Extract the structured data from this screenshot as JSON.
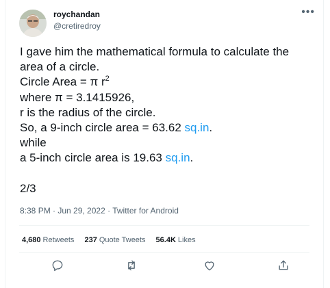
{
  "author": {
    "name": "roychandan",
    "handle": "@cretiredroy"
  },
  "tweet": {
    "line1": "I gave him the  mathematical formula to calculate the",
    "line2": "area of a circle.",
    "line3_text": "Circle Area = π r",
    "line3_sup": "2",
    "line4": "where π = 3.1415926,",
    "line5": "r is the radius of the circle.",
    "line6_text": "So, a 9-inch circle area = 63.62 ",
    "line6_link": "sq.in",
    "line6_end": ".",
    "line7": "while",
    "line8_text": "a 5-inch circle area is 19.63 ",
    "line8_link": "sq.in",
    "line8_end": ".",
    "thread_position": "2/3"
  },
  "meta": "8:38 PM · Jun 29, 2022 · Twitter for Android",
  "stats": {
    "retweets_count": "4,680",
    "retweets_label": "Retweets",
    "quotes_count": "237",
    "quotes_label": "Quote Tweets",
    "likes_count": "56.4K",
    "likes_label": "Likes"
  },
  "icons": {
    "more": "more-icon",
    "reply": "reply-icon",
    "retweet": "retweet-icon",
    "like": "heart-icon",
    "share": "share-icon"
  },
  "colors": {
    "link": "#1d9bf0",
    "secondary_text": "#536471",
    "primary_text": "#0f1419"
  }
}
